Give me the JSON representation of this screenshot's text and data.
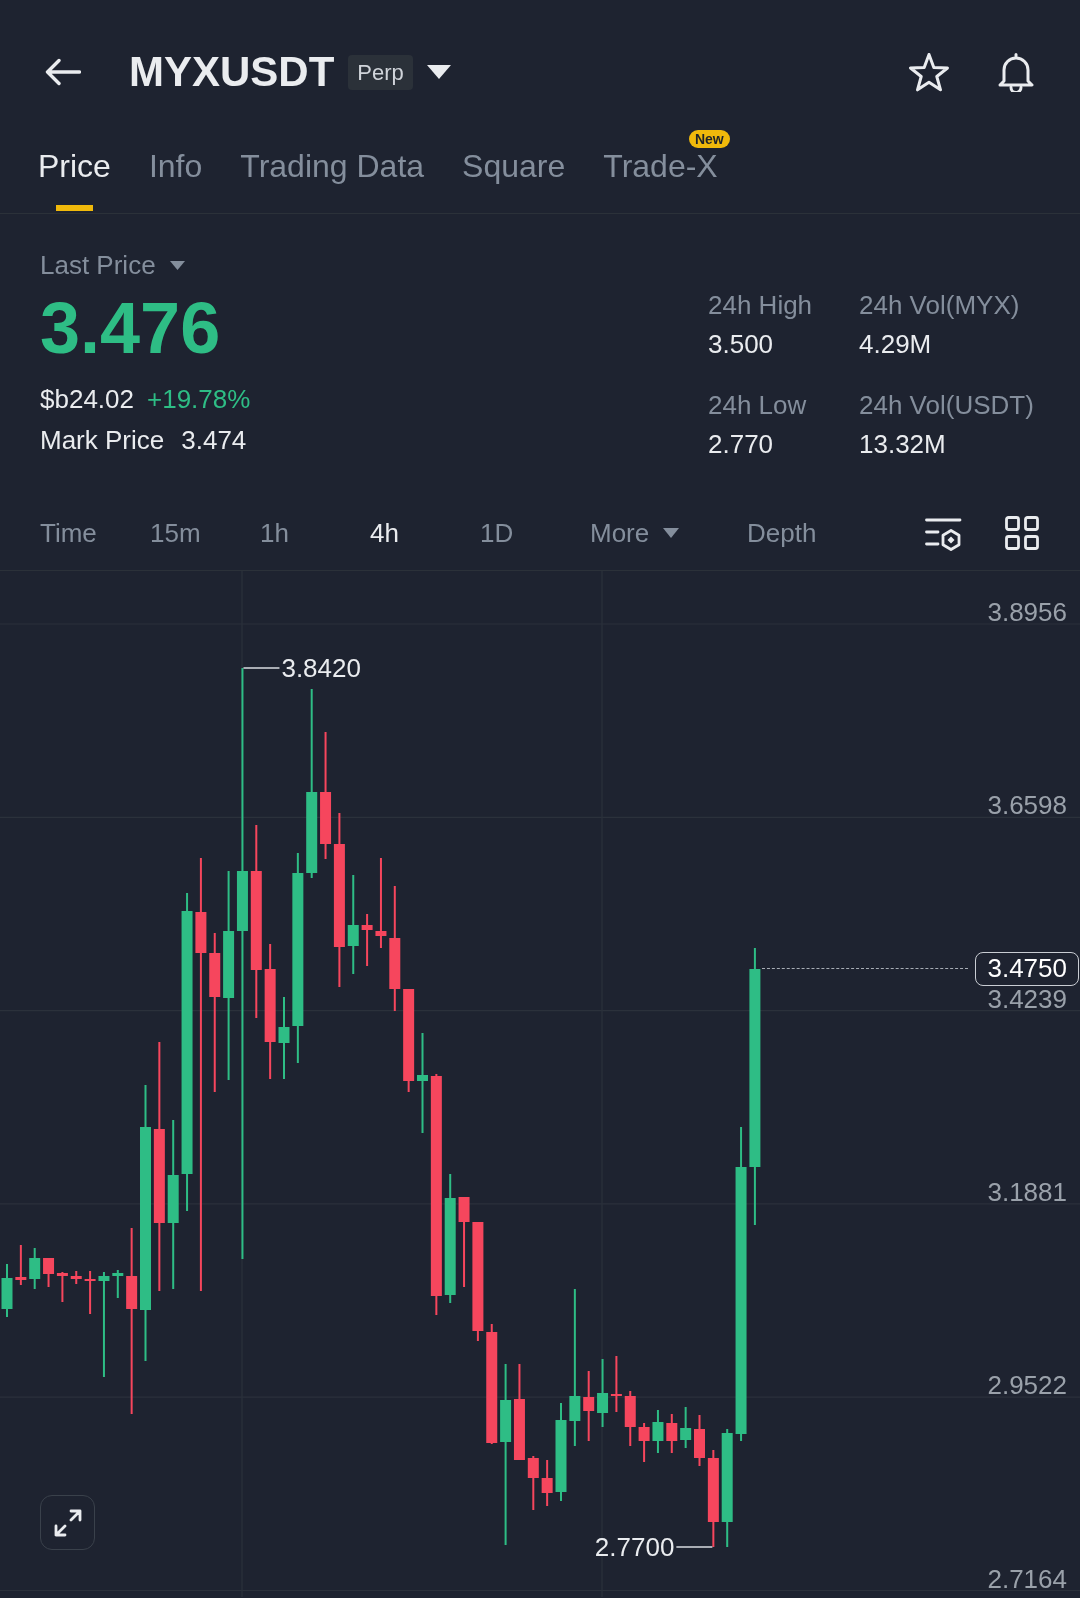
{
  "header": {
    "symbol": "MYXUSDT",
    "contract_badge": "Perp"
  },
  "tabs": [
    {
      "label": "Price",
      "selected": true
    },
    {
      "label": "Info",
      "selected": false
    },
    {
      "label": "Trading Data",
      "selected": false
    },
    {
      "label": "Square",
      "selected": false
    },
    {
      "label": "Trade-X",
      "selected": false,
      "badge": "New"
    }
  ],
  "price_summary": {
    "price_type": "Last Price",
    "last_price": "3.476",
    "rising": true,
    "fiat_value": "$b24.02",
    "change": "+19.78%",
    "mark_price_label": "Mark Price",
    "mark_price": "3.474"
  },
  "stats": [
    {
      "label": "24h High",
      "value": "3.500"
    },
    {
      "label": "24h Vol(MYX)",
      "value": "4.29M"
    },
    {
      "label": "24h Low",
      "value": "2.770"
    },
    {
      "label": "24h Vol(USDT)",
      "value": "13.32M"
    }
  ],
  "chart_tabs": [
    {
      "label": "Time",
      "kind": "tab",
      "selected": false
    },
    {
      "label": "15m",
      "kind": "tab",
      "selected": false
    },
    {
      "label": "1h",
      "kind": "tab",
      "selected": false
    },
    {
      "label": "4h",
      "kind": "tab",
      "selected": true
    },
    {
      "label": "1D",
      "kind": "tab",
      "selected": false
    },
    {
      "label": "More",
      "kind": "dropdown",
      "selected": false
    },
    {
      "label": "Depth",
      "kind": "tab",
      "selected": false
    }
  ],
  "chart": {
    "price_axis": [
      "3.8956",
      "3.6598",
      "3.4239",
      "3.1881",
      "2.9522",
      "2.7164"
    ],
    "high_label": "3.8420",
    "low_label": "2.7700",
    "current_price": "3.4750"
  }
}
